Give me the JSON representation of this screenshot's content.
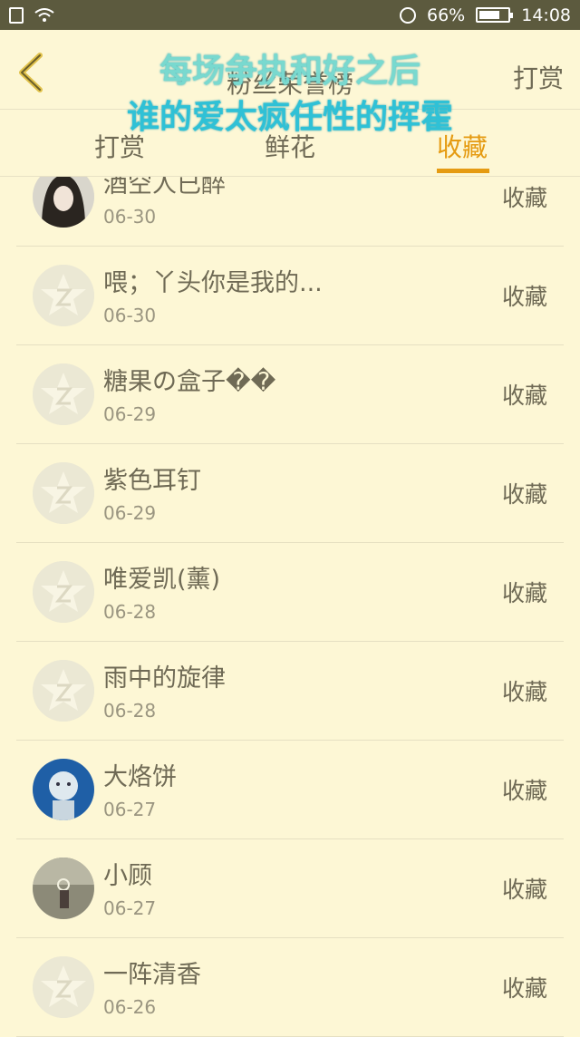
{
  "statusbar": {
    "battery": "66%",
    "time": "14:08"
  },
  "header": {
    "title": "粉丝荣誉榜",
    "right_button": "打赏",
    "overlay_line1": "每场争执和好之后",
    "overlay_line2": "谁的爱太疯任性的挥霍"
  },
  "tabs": [
    {
      "label": "打赏",
      "active": false
    },
    {
      "label": "鲜花",
      "active": false
    },
    {
      "label": "收藏",
      "active": true
    }
  ],
  "list": [
    {
      "name": "酒空人已醉",
      "date": "06-30",
      "action": "收藏",
      "avatar": "photo-dark"
    },
    {
      "name": "喂；丫头你是我的...",
      "date": "06-30",
      "action": "收藏",
      "avatar": "default"
    },
    {
      "name": "糖果の盒子��",
      "date": "06-29",
      "action": "收藏",
      "avatar": "default"
    },
    {
      "name": "紫色耳钉",
      "date": "06-29",
      "action": "收藏",
      "avatar": "default"
    },
    {
      "name": "唯爱凯(薰)",
      "date": "06-28",
      "action": "收藏",
      "avatar": "default"
    },
    {
      "name": "雨中的旋律",
      "date": "06-28",
      "action": "收藏",
      "avatar": "default"
    },
    {
      "name": "大烙饼",
      "date": "06-27",
      "action": "收藏",
      "avatar": "photo-blue"
    },
    {
      "name": "小顾",
      "date": "06-27",
      "action": "收藏",
      "avatar": "photo-gray"
    },
    {
      "name": "一阵清香",
      "date": "06-26",
      "action": "收藏",
      "avatar": "default"
    }
  ],
  "colors": {
    "background": "#fdf7d5",
    "accent": "#e59b12",
    "statusbar": "#5c5a3e"
  }
}
